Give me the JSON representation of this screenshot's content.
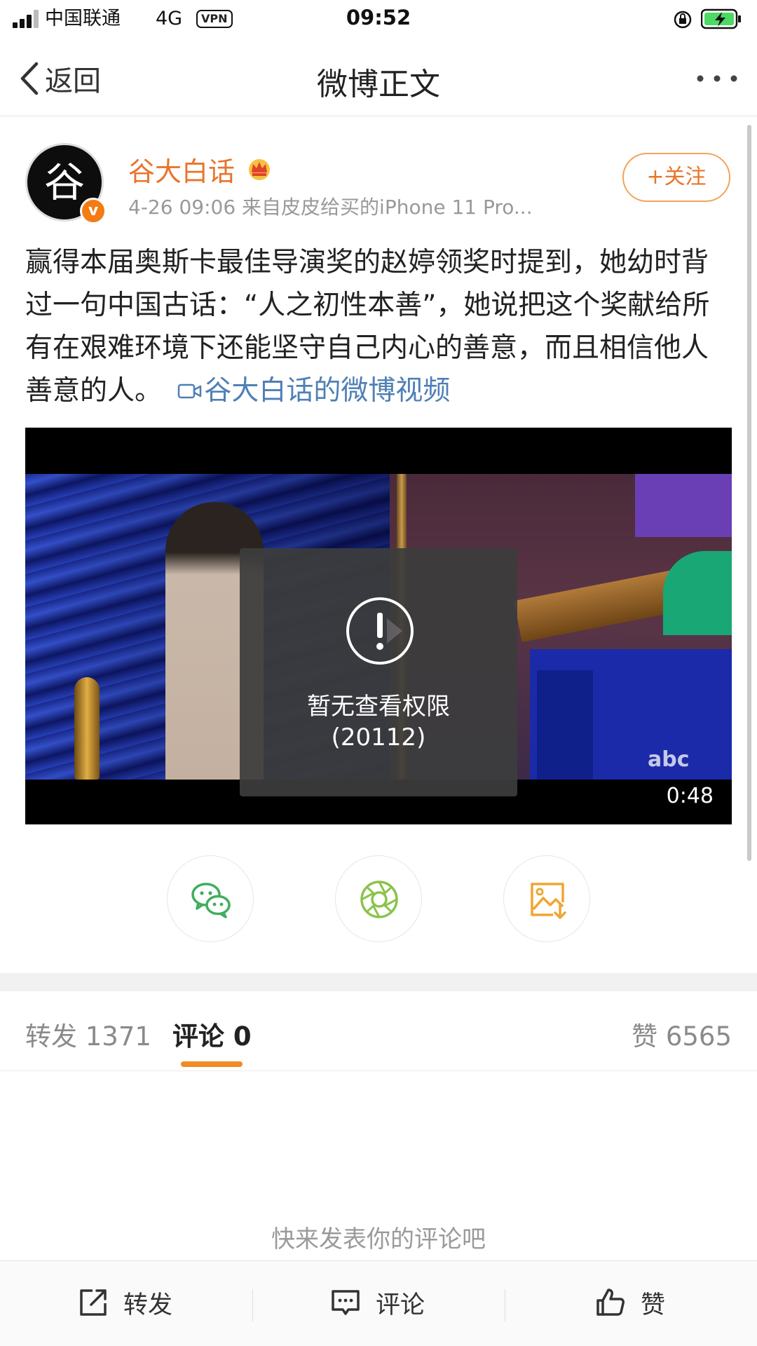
{
  "status_bar": {
    "carrier": "中国联通",
    "network": "4G",
    "vpn": "VPN",
    "time": "09:52"
  },
  "nav": {
    "back_label": "返回",
    "title": "微博正文"
  },
  "post": {
    "author": "谷大白话",
    "avatar_glyph": "谷",
    "verified_mark": "v",
    "meta": "4-26 09:06  来自皮皮给买的iPhone 11 Pro...",
    "follow_label": "+关注",
    "text": "赢得本届奥斯卡最佳导演奖的赵婷领奖时提到，她幼时背过一句中国古话：“人之初性本善”，她说把这个奖献给所有在艰难环境下还能坚守自己内心的善意，而且相信他人善意的人。",
    "video_link": "谷大白话的微博视频"
  },
  "video": {
    "error_line1": "暂无查看权限",
    "error_line2": "(20112)",
    "duration": "0:48",
    "watermark": "abc"
  },
  "share": {
    "items": [
      {
        "name": "wechat",
        "icon": "wechat-icon"
      },
      {
        "name": "moments",
        "icon": "moments-icon"
      },
      {
        "name": "save-image",
        "icon": "image-download-icon"
      }
    ]
  },
  "tabs": {
    "repost_label": "转发",
    "repost_count": "1371",
    "comment_label": "评论",
    "comment_count": "0",
    "like_label": "赞",
    "like_count": "6565"
  },
  "comments": {
    "empty_hint": "快来发表你的评论吧"
  },
  "toolbar": {
    "repost_label": "转发",
    "comment_label": "评论",
    "like_label": "赞"
  },
  "colors": {
    "accent_orange": "#e8742b",
    "link_blue": "#4f7fb5",
    "tab_underline": "#f28a25",
    "wechat_green": "#3fae5d",
    "moments_green": "#8bc34a",
    "save_orange": "#f0a532"
  }
}
